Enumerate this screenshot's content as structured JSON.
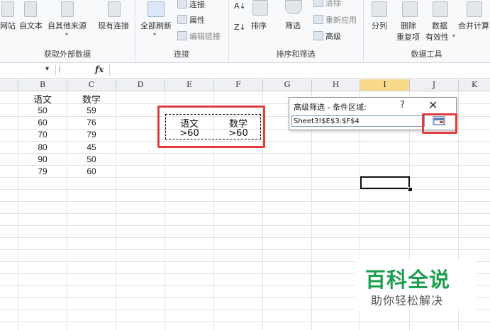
{
  "ribbon": {
    "get_external_data": {
      "items": [
        "网站",
        "自文本",
        "自其他来源",
        "现有连接"
      ],
      "label": "获取外部数据"
    },
    "connections": {
      "refresh_all": "全部刷新",
      "connections": "连接",
      "properties": "属性",
      "edit_links": "编辑链接",
      "label": "连接"
    },
    "sort_filter": {
      "sort": "排序",
      "filter": "筛选",
      "clear": "清除",
      "reapply": "重新应用",
      "advanced": "高级",
      "label": "排序和筛选"
    },
    "data_tools": {
      "text_to_columns": "分列",
      "remove_dup_line1": "删除",
      "remove_dup_line2": "重复项",
      "validation_line1": "数据",
      "validation_line2": "有效性",
      "consolidate": "合并计算",
      "label": "数据工具"
    }
  },
  "formula_bar": {
    "fx": "fx"
  },
  "columns": [
    "B",
    "C",
    "D",
    "E",
    "F",
    "G",
    "H",
    "I",
    "J",
    "K"
  ],
  "table": {
    "headers": [
      "语文",
      "数学"
    ],
    "rows": [
      [
        "50",
        "59"
      ],
      [
        "60",
        "76"
      ],
      [
        "70",
        "79"
      ],
      [
        "80",
        "45"
      ],
      [
        "90",
        "50"
      ],
      [
        "79",
        "60"
      ]
    ]
  },
  "criteria": {
    "headers": [
      "语文",
      "数学"
    ],
    "values": [
      ">60",
      ">60"
    ]
  },
  "dialog": {
    "title": "高级筛选 - 条件区域:",
    "help": "?",
    "close": "✕",
    "range_value": "Sheet3!$E$3:$F$4"
  },
  "watermark": {
    "title": "百科全说",
    "subtitle": "助你轻松解决"
  },
  "colors": {
    "highlight_red": "#e23d3d",
    "selected_column": "#f9d98a",
    "watermark_green": "#1e9e4f"
  }
}
